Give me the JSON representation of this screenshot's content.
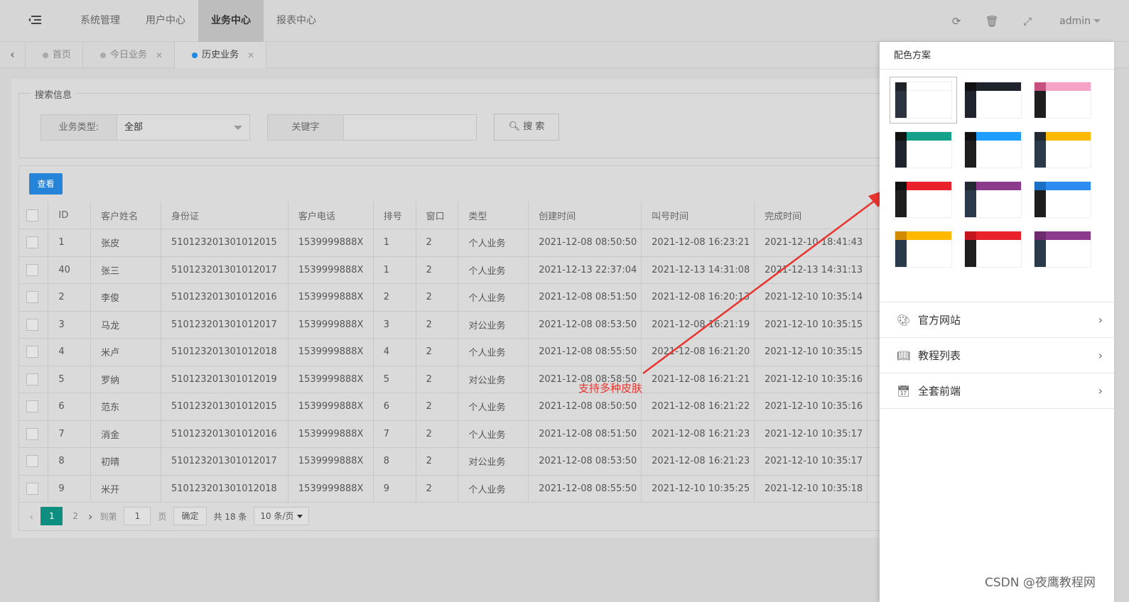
{
  "header": {
    "nav": [
      "系统管理",
      "用户中心",
      "业务中心",
      "报表中心"
    ],
    "active_nav": 2,
    "tools": {
      "refresh": "⟳",
      "trash": "🗑",
      "fullscreen": "⤢"
    },
    "user": "admin"
  },
  "tabs": [
    {
      "label": "首页",
      "closable": false
    },
    {
      "label": "今日业务",
      "closable": true
    },
    {
      "label": "历史业务",
      "closable": true,
      "active": true
    }
  ],
  "search": {
    "legend": "搜索信息",
    "type_label": "业务类型:",
    "type_value": "全部",
    "keyword_label": "关键字",
    "search_button": "搜 索"
  },
  "toolbar": {
    "view_button": "查看"
  },
  "table": {
    "columns": [
      "ID",
      "客户姓名",
      "身份证",
      "客户电话",
      "排号",
      "窗口",
      "类型",
      "创建时间",
      "叫号时间",
      "完成时间"
    ],
    "rows": [
      [
        "1",
        "张皮",
        "510123201301012015",
        "1539999888X",
        "1",
        "2",
        "个人业务",
        "2021-12-08 08:50:50",
        "2021-12-08 16:23:21",
        "2021-12-10 18:41:43"
      ],
      [
        "40",
        "张三",
        "510123201301012017",
        "1539999888X",
        "1",
        "2",
        "个人业务",
        "2021-12-13 22:37:04",
        "2021-12-13 14:31:08",
        "2021-12-13 14:31:13"
      ],
      [
        "2",
        "李俊",
        "510123201301012016",
        "1539999888X",
        "2",
        "2",
        "个人业务",
        "2021-12-08 08:51:50",
        "2021-12-08 16:20:13",
        "2021-12-10 10:35:14"
      ],
      [
        "3",
        "马龙",
        "510123201301012017",
        "1539999888X",
        "3",
        "2",
        "对公业务",
        "2021-12-08 08:53:50",
        "2021-12-08 16:21:19",
        "2021-12-10 10:35:15"
      ],
      [
        "4",
        "米卢",
        "510123201301012018",
        "1539999888X",
        "4",
        "2",
        "个人业务",
        "2021-12-08 08:55:50",
        "2021-12-08 16:21:20",
        "2021-12-10 10:35:15"
      ],
      [
        "5",
        "罗纳",
        "510123201301012019",
        "1539999888X",
        "5",
        "2",
        "对公业务",
        "2021-12-08 08:58:50",
        "2021-12-08 16:21:21",
        "2021-12-10 10:35:16"
      ],
      [
        "6",
        "范东",
        "510123201301012015",
        "1539999888X",
        "6",
        "2",
        "个人业务",
        "2021-12-08 08:50:50",
        "2021-12-08 16:21:22",
        "2021-12-10 10:35:16"
      ],
      [
        "7",
        "消金",
        "510123201301012016",
        "1539999888X",
        "7",
        "2",
        "个人业务",
        "2021-12-08 08:51:50",
        "2021-12-08 16:21:23",
        "2021-12-10 10:35:17"
      ],
      [
        "8",
        "初晴",
        "510123201301012017",
        "1539999888X",
        "8",
        "2",
        "对公业务",
        "2021-12-08 08:53:50",
        "2021-12-08 16:21:23",
        "2021-12-10 10:35:17"
      ],
      [
        "9",
        "米开",
        "510123201301012018",
        "1539999888X",
        "9",
        "2",
        "个人业务",
        "2021-12-08 08:55:50",
        "2021-12-10 10:35:25",
        "2021-12-10 10:35:18"
      ]
    ]
  },
  "pagination": {
    "pages": [
      "1",
      "2"
    ],
    "current": "1",
    "goto_label": "到第",
    "goto_value": "1",
    "page_unit": "页",
    "confirm": "确定",
    "total": "共 18 条",
    "page_size": "10 条/页"
  },
  "annotation": {
    "text": "支持多种皮肤",
    "color": "#e8332e"
  },
  "panel": {
    "title": "配色方案",
    "swatches": [
      {
        "corner": "#1f2328",
        "side": "#2b3440",
        "head": "#ffffff",
        "selected": true
      },
      {
        "corner": "#111111",
        "side": "#1f232b",
        "head": "#1f232b"
      },
      {
        "corner": "#c8507e",
        "side": "#1e1e1e",
        "head": "#f5a3c7"
      },
      {
        "corner": "#111111",
        "side": "#1f232b",
        "head": "#15a08c"
      },
      {
        "corner": "#111111",
        "side": "#1e1e1e",
        "head": "#1e9fff"
      },
      {
        "corner": "#222933",
        "side": "#2b3a4a",
        "head": "#ffb800"
      },
      {
        "corner": "#111111",
        "side": "#1e1e1e",
        "head": "#e8212b"
      },
      {
        "corner": "#222933",
        "side": "#2b3a4a",
        "head": "#8c3b8c"
      },
      {
        "corner": "#1b6fc5",
        "side": "#1e1e1e",
        "head": "#2d8cf0"
      },
      {
        "corner": "#d08b00",
        "side": "#2b3a4a",
        "head": "#ffb800"
      },
      {
        "corner": "#c4141d",
        "side": "#1e1e1e",
        "head": "#e8212b"
      },
      {
        "corner": "#6e2a6e",
        "side": "#2b3a4a",
        "head": "#8c3b8c"
      }
    ],
    "links": [
      {
        "label": "官方网站",
        "icon": "palette-icon"
      },
      {
        "label": "教程列表",
        "icon": "book-icon"
      },
      {
        "label": "全套前端",
        "icon": "calendar-icon"
      }
    ]
  },
  "watermark": "CSDN @夜鹰教程网"
}
